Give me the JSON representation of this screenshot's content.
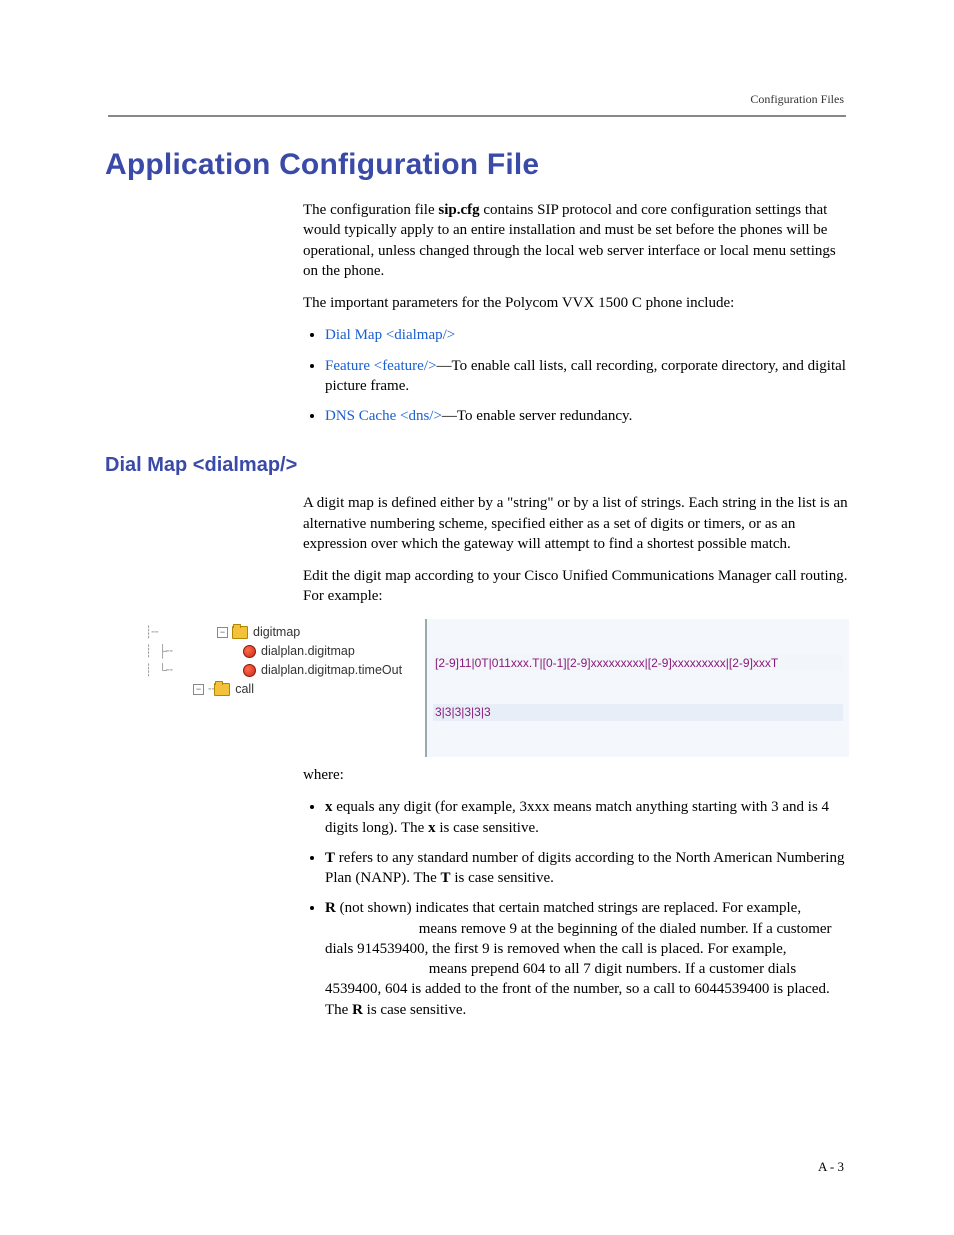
{
  "header": {
    "right": "Configuration Files"
  },
  "h1": "Application Configuration File",
  "intro": {
    "p1a": "The configuration file ",
    "p1_file": "sip.cfg",
    "p1b": " contains SIP protocol and core configuration settings that would typically apply to an entire installation and must be set before the phones will be operational, unless changed through the local web server interface or local menu settings on the phone.",
    "p2": "The important parameters for the Polycom VVX 1500 C phone include:"
  },
  "bullets1": {
    "b1_link": "Dial Map <dialmap/>",
    "b2_link": "Feature <feature/>",
    "b2_rest": "—To enable call lists, call recording, corporate directory, and digital picture frame.",
    "b3_link": "DNS Cache <dns/>",
    "b3_rest": "—To enable server redundancy."
  },
  "h2": "Dial Map <dialmap/>",
  "dial": {
    "p1": "A digit map is defined either by a \"string\" or by a list of strings. Each string in the list is an alternative numbering scheme, specified either as a set of digits or timers, or as an expression over which the gateway will attempt to find a shortest possible match.",
    "p2": "Edit the digit map according to your Cisco Unified Communications Manager call routing. For example:"
  },
  "tree": {
    "node1": "digitmap",
    "leaf1": "dialplan.digitmap",
    "leaf2": "dialplan.digitmap.timeOut",
    "node2": "call",
    "val_line1": "[2-9]11|0T|011xxx.T|[0-1][2-9]xxxxxxxxx|[2-9]xxxxxxxxx|[2-9]xxxT",
    "val_line2": "3|3|3|3|3|3"
  },
  "where": {
    "lead": "where:",
    "x_a": "x",
    "x_b": " equals any digit (for example, 3xxx means match anything starting with 3 and is 4 digits long). The ",
    "x_c": "x",
    "x_d": " is case sensitive.",
    "t_a": "T",
    "t_b": " refers to any standard number of digits according to the North American Numbering Plan (NANP). The ",
    "t_c": "T",
    "t_d": " is case sensitive.",
    "r_a": "R",
    "r_b": " (not shown) indicates that certain matched strings are replaced. For example, ",
    "r_c": " means remove 9 at the beginning of the dialed number. If a customer dials 914539400, the first 9 is removed when the call is placed. For example, ",
    "r_d": " means prepend 604 to all 7 digit numbers. If a customer dials 4539400, 604 is added to the front of the number, so a call to 6044539400 is placed. The ",
    "r_e": "R",
    "r_f": " is case sensitive."
  },
  "footer": {
    "page": "A - 3"
  }
}
